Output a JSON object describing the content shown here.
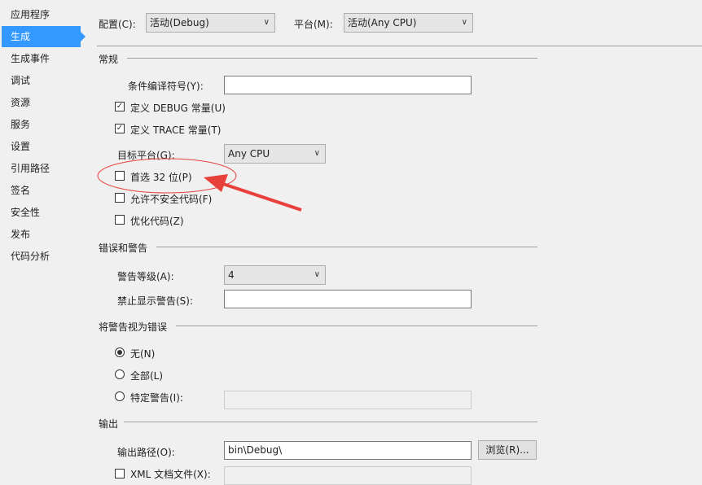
{
  "sidebar": {
    "items": [
      {
        "label": "应用程序"
      },
      {
        "label": "生成",
        "active": true
      },
      {
        "label": "生成事件"
      },
      {
        "label": "调试"
      },
      {
        "label": "资源"
      },
      {
        "label": "服务"
      },
      {
        "label": "设置"
      },
      {
        "label": "引用路径"
      },
      {
        "label": "签名"
      },
      {
        "label": "安全性"
      },
      {
        "label": "发布"
      },
      {
        "label": "代码分析"
      }
    ]
  },
  "top": {
    "config_label": "配置(C):",
    "config_value": "活动(Debug)",
    "platform_label": "平台(M):",
    "platform_value": "活动(Any CPU)"
  },
  "general": {
    "heading": "常规",
    "cond_symbols_label": "条件编译符号(Y):",
    "cond_symbols_value": "",
    "define_debug": "定义 DEBUG 常量(U)",
    "define_debug_checked": true,
    "define_trace": "定义 TRACE 常量(T)",
    "define_trace_checked": true,
    "target_label": "目标平台(G):",
    "target_value": "Any CPU",
    "prefer32": "首选 32 位(P)",
    "prefer32_checked": false,
    "unsafe": "允许不安全代码(F)",
    "unsafe_checked": false,
    "optimize": "优化代码(Z)",
    "optimize_checked": false
  },
  "errors": {
    "heading": "错误和警告",
    "level_label": "警告等级(A):",
    "level_value": "4",
    "suppress_label": "禁止显示警告(S):",
    "suppress_value": ""
  },
  "treat": {
    "heading": "将警告视为错误",
    "none": "无(N)",
    "all": "全部(L)",
    "specific": "特定警告(I):",
    "selected": "none",
    "specific_value": ""
  },
  "output": {
    "heading": "输出",
    "path_label": "输出路径(O):",
    "path_value": "bin\\Debug\\",
    "browse": "浏览(R)...",
    "xml_label": "XML 文档文件(X):"
  },
  "annotation": {
    "color": "#e8413c"
  }
}
